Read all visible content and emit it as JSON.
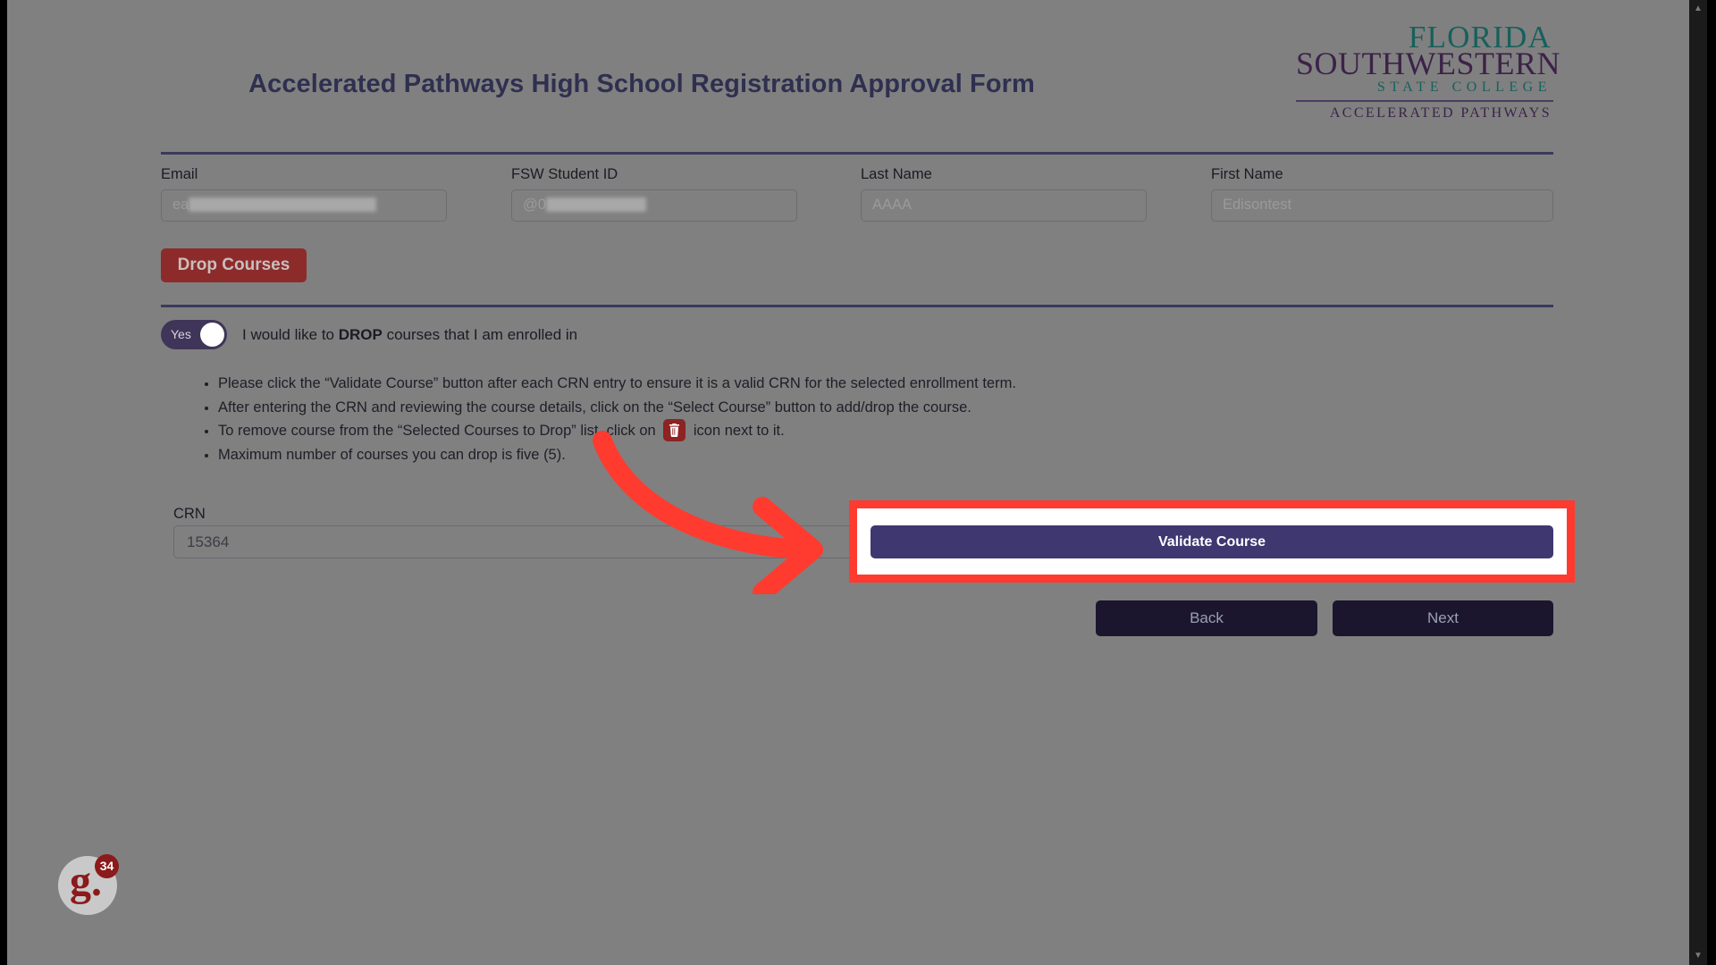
{
  "header": {
    "title": "Accelerated Pathways High School Registration Approval Form",
    "logo": {
      "line1": "FLORIDA",
      "line2": "SOUTHWESTERN",
      "line3": "STATE COLLEGE",
      "line4": "ACCELERATED PATHWAYS"
    }
  },
  "fields": {
    "email": {
      "label": "Email",
      "value": "ea"
    },
    "student_id": {
      "label": "FSW Student ID",
      "value": "@0"
    },
    "last_name": {
      "label": "Last Name",
      "value": "AAAA"
    },
    "first_name": {
      "label": "First Name",
      "value": "Edisontest"
    }
  },
  "section": {
    "drop_courses_button": "Drop Courses",
    "toggle": {
      "state_label": "Yes",
      "text_before": "I would like to ",
      "text_bold": "DROP",
      "text_after": " courses that I am enrolled in"
    },
    "instructions": [
      "Please click the “Validate Course” button after each CRN entry to ensure it is a valid CRN for the selected enrollment term.",
      "After entering the CRN and reviewing the course details, click on the “Select Course” button to add/drop the course.",
      "Maximum number of courses you can drop is five (5)."
    ],
    "instruction_with_icon": {
      "before": "To remove course from the “Selected Courses to Drop” list, click on ",
      "icon": "trash-icon",
      "after": " icon next to it."
    }
  },
  "crn": {
    "label": "CRN",
    "value": "15364",
    "placeholder": "CRN"
  },
  "actions": {
    "validate_course": "Validate Course",
    "back": "Back",
    "next": "Next"
  },
  "chat_widget": {
    "mark": "g.",
    "badge": "34"
  },
  "scrollbar": {
    "up_arrow": "▲",
    "down_arrow": "▼"
  },
  "colors": {
    "page_background": "#808080",
    "accent_purple": "#3f3770",
    "rule": "#3b3a5c",
    "drop_red": "#8d2b2b",
    "nav_dark": "#1b162e",
    "highlight_red": "#ff3b2f",
    "logo_teal": "#17605c",
    "logo_purple": "#3c2248"
  }
}
